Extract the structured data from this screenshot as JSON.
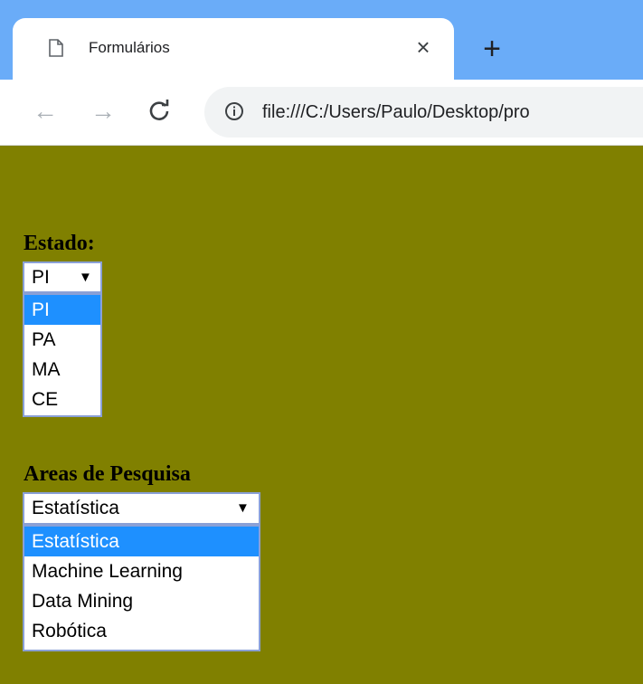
{
  "browser": {
    "tab_title": "Formulários",
    "close_glyph": "×",
    "new_tab_glyph": "+",
    "back_glyph": "←",
    "forward_glyph": "→",
    "reload_glyph": "C",
    "url": "file:///C:/Users/Paulo/Desktop/pro"
  },
  "form": {
    "estado": {
      "label": "Estado:",
      "selected": "PI",
      "options": [
        "PI",
        "PA",
        "MA",
        "CE"
      ]
    },
    "areas": {
      "label": "Areas de Pesquisa",
      "selected": "Estatística",
      "options": [
        "Estatística",
        "Machine Learning",
        "Data Mining",
        "Robótica"
      ]
    }
  },
  "colors": {
    "page_background": "#808000",
    "tabstrip": "#6aacf8",
    "highlight": "#1e90ff"
  }
}
